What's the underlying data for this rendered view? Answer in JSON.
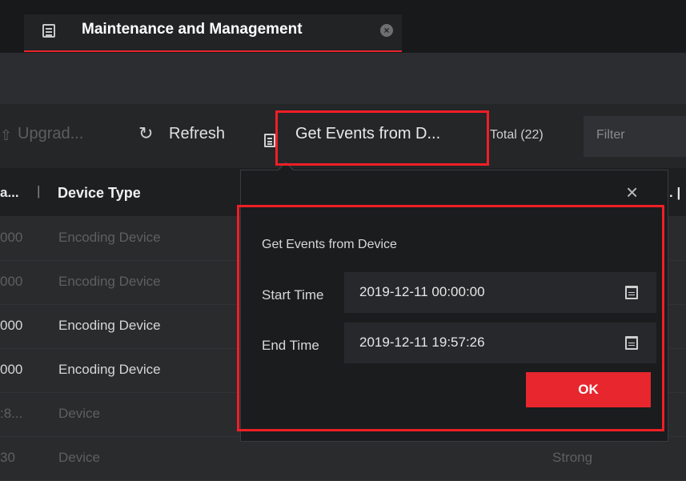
{
  "tab": {
    "title": "Maintenance and Management",
    "close": "×"
  },
  "toolbar": {
    "upgrade_label": "Upgrad...",
    "refresh_label": "Refresh",
    "get_events_label": "Get Events from D...",
    "total_label": "Total (22)",
    "filter_placeholder": "Filter"
  },
  "table": {
    "headers": {
      "truncated_left": "a...",
      "separator": "|",
      "device_type": "Device Type",
      "truncated_right": ". |"
    },
    "rows": [
      {
        "c1": "000",
        "c2": "Encoding Device",
        "c3": ""
      },
      {
        "c1": "000",
        "c2": "Encoding Device",
        "c3": ""
      },
      {
        "c1": "000",
        "c2": "Encoding Device",
        "c3": ""
      },
      {
        "c1": "000",
        "c2": "Encoding Device",
        "c3": ""
      },
      {
        "c1": ":8...",
        "c2": "Device",
        "c3": ""
      },
      {
        "c1": "30",
        "c2": "Device",
        "c3": "Strong"
      }
    ]
  },
  "popover": {
    "close": "×",
    "title": "Get Events from Device",
    "start_label": "Start Time",
    "start_value": "2019-12-11 00:00:00",
    "end_label": "End Time",
    "end_value": "2019-12-11 19:57:26",
    "ok_label": "OK"
  },
  "colors": {
    "accent": "#e8262d",
    "highlight": "#ee1f26"
  },
  "icons": {
    "tab": "maintenance-icon",
    "upgrade": "upload-icon",
    "refresh": "refresh-icon",
    "get_events": "document-icon",
    "calendar": "calendar-icon",
    "close": "close-icon"
  }
}
